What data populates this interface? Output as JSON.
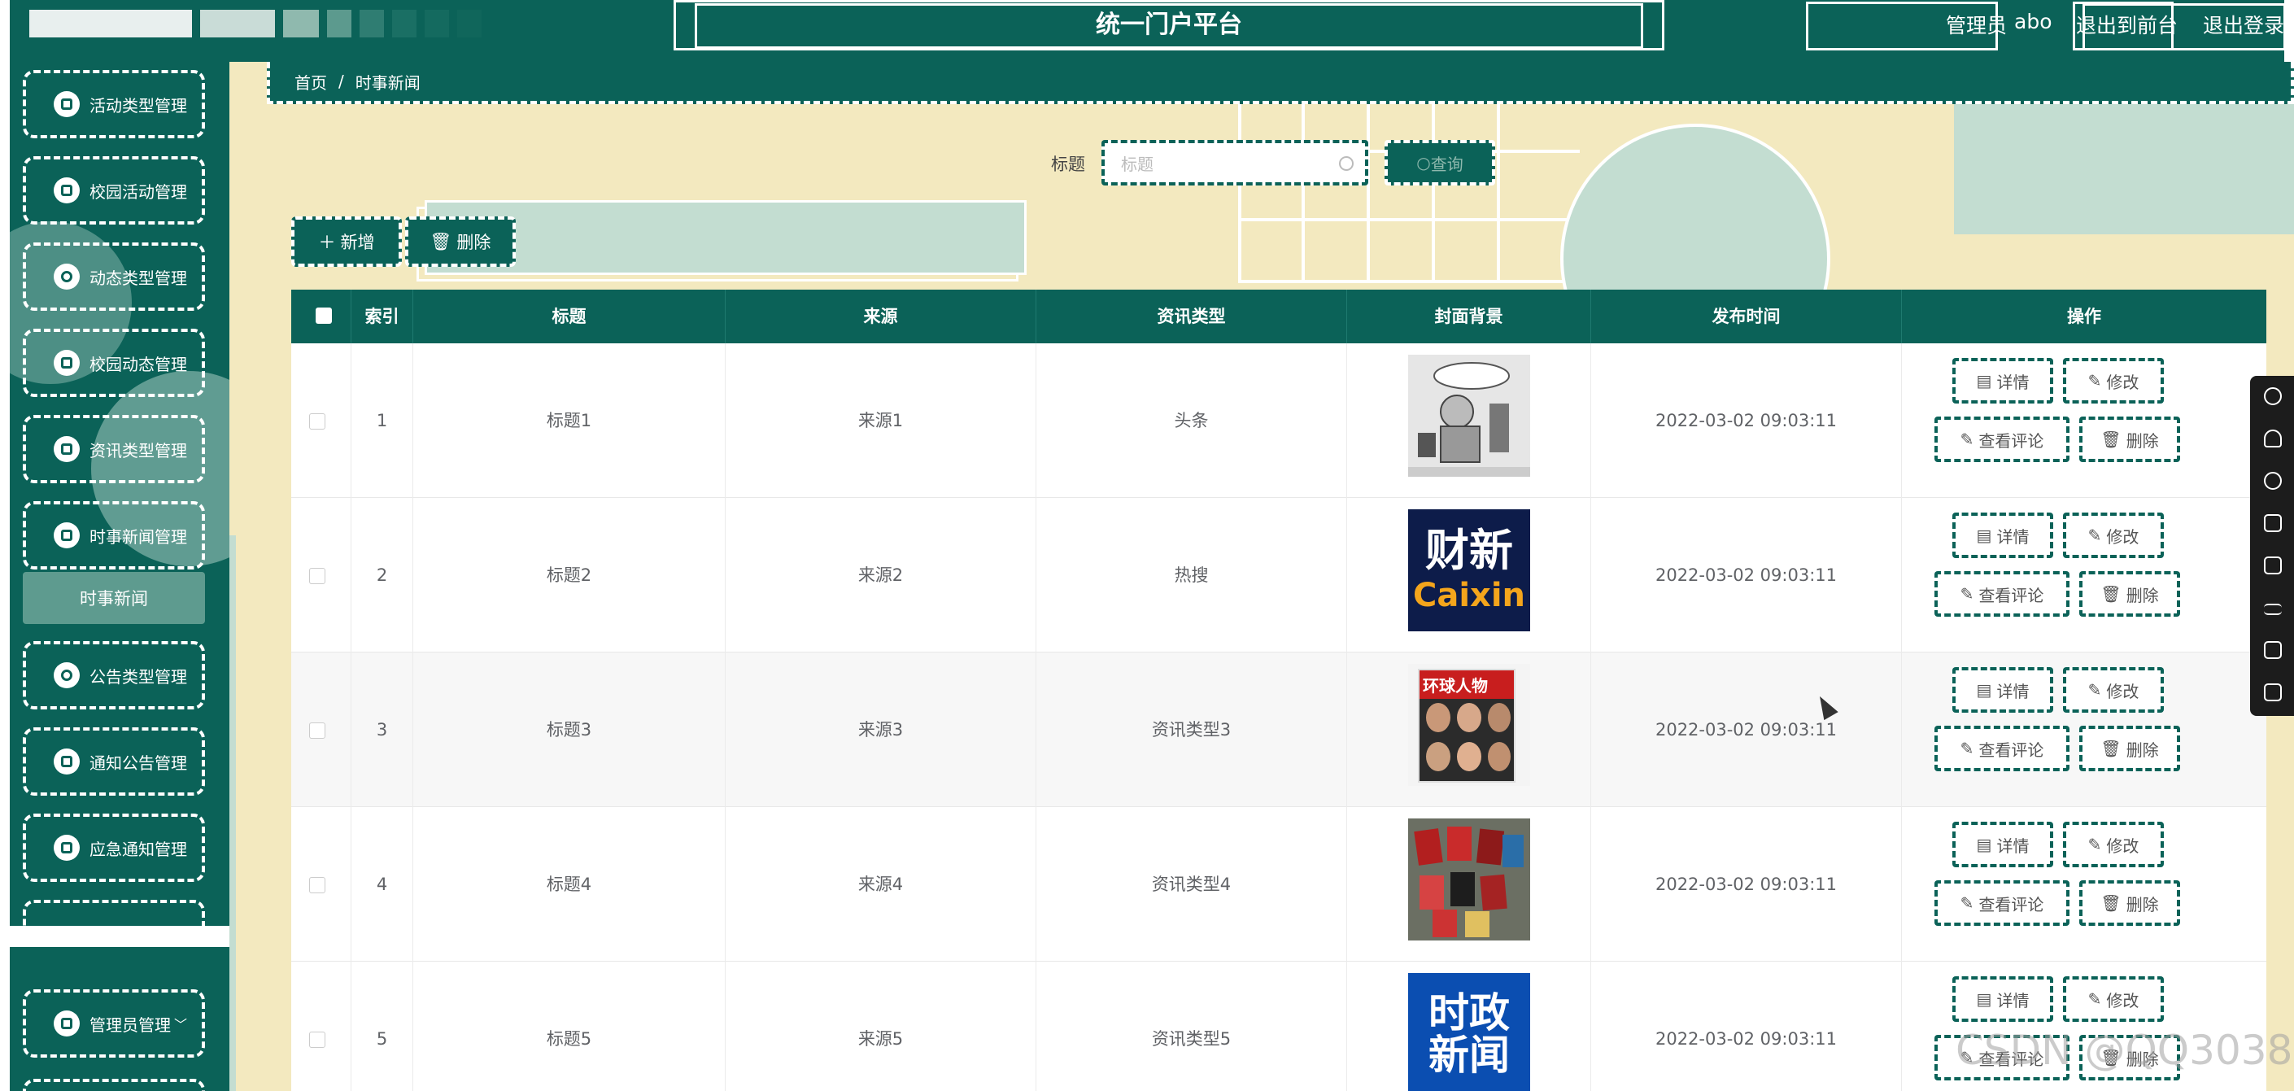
{
  "header": {
    "app_title": "统一门户平台",
    "user_role": "管理员",
    "username": "abo",
    "back_to_front": "退出到前台",
    "logout": "退出登录"
  },
  "sidebar": {
    "items": [
      {
        "label": "活动类型管理",
        "icon": "list-icon"
      },
      {
        "label": "校园活动管理",
        "icon": "grid-icon"
      },
      {
        "label": "动态类型管理",
        "icon": "user-icon"
      },
      {
        "label": "校园动态管理",
        "icon": "grid-icon"
      },
      {
        "label": "资讯类型管理",
        "icon": "grid-icon"
      },
      {
        "label": "时事新闻管理",
        "icon": "flag-icon"
      }
    ],
    "active_sub": "时事新闻",
    "items2": [
      {
        "label": "公告类型管理",
        "icon": "location-icon"
      },
      {
        "label": "通知公告管理",
        "icon": "grid-icon"
      },
      {
        "label": "应急通知管理",
        "icon": "doc-icon"
      }
    ],
    "admin": {
      "label": "管理员管理",
      "icon": "grid-icon"
    }
  },
  "breadcrumb": {
    "home": "首页",
    "separator": "/",
    "current": "时事新闻"
  },
  "search": {
    "label": "标题",
    "placeholder": "标题",
    "button": "查询"
  },
  "toolbar": {
    "add": "新增",
    "delete": "删除"
  },
  "table": {
    "columns": [
      "索引",
      "标题",
      "来源",
      "资讯类型",
      "封面背景",
      "发布时间",
      "操作"
    ],
    "rows": [
      {
        "index": "1",
        "title": "标题1",
        "source": "来源1",
        "type": "头条",
        "cover": "cartoon",
        "time": "2022-03-02 09:03:11"
      },
      {
        "index": "2",
        "title": "标题2",
        "source": "来源2",
        "type": "热搜",
        "cover": "caixin",
        "time": "2022-03-02 09:03:11"
      },
      {
        "index": "3",
        "title": "标题3",
        "source": "来源3",
        "type": "资讯类型3",
        "cover": "magazine",
        "time": "2022-03-02 09:03:11"
      },
      {
        "index": "4",
        "title": "标题4",
        "source": "来源4",
        "type": "资讯类型4",
        "cover": "books",
        "time": "2022-03-02 09:03:11"
      },
      {
        "index": "5",
        "title": "标题5",
        "source": "来源5",
        "type": "资讯类型5",
        "cover": "politics",
        "time": "2022-03-02 09:03:11"
      }
    ],
    "ops": {
      "detail": "详情",
      "edit": "修改",
      "comments": "查看评论",
      "delete": "删除"
    },
    "cover_text": {
      "caixin_cn": "财新",
      "caixin_en": "Caixin",
      "magazine": "环球人物",
      "politics_1": "时政",
      "politics_2": "新闻"
    }
  },
  "watermark": "CSDN @QQ3038",
  "colors": {
    "primary": "#0b6258",
    "background": "#f3e9bf",
    "accent": "#c3ddd1"
  }
}
